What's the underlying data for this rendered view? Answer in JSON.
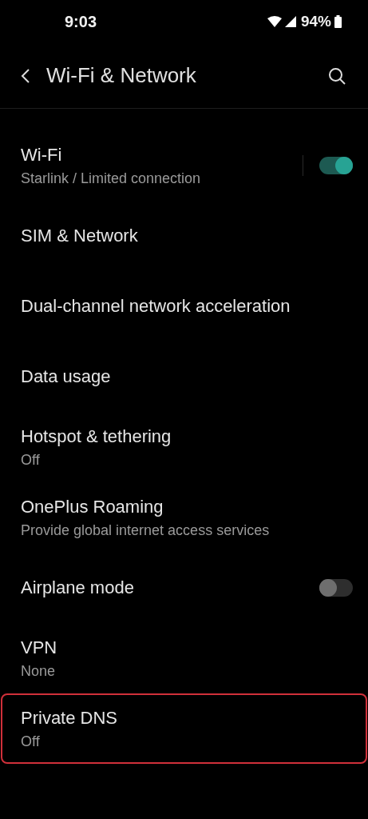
{
  "status_bar": {
    "time": "9:03",
    "battery": "94%"
  },
  "header": {
    "title": "Wi-Fi & Network"
  },
  "items": [
    {
      "kind": "toggle",
      "title": "Wi-Fi",
      "subtitle": "Starlink / Limited connection",
      "on": true,
      "highlighted": false
    },
    {
      "kind": "link",
      "title": "SIM & Network",
      "highlighted": false
    },
    {
      "kind": "link",
      "title": "Dual-channel network acceleration",
      "highlighted": false
    },
    {
      "kind": "link",
      "title": "Data usage",
      "highlighted": false
    },
    {
      "kind": "link",
      "title": "Hotspot & tethering",
      "subtitle": "Off",
      "highlighted": false
    },
    {
      "kind": "link",
      "title": "OnePlus Roaming",
      "subtitle": "Provide global internet access services",
      "highlighted": false
    },
    {
      "kind": "toggle",
      "title": "Airplane mode",
      "on": false,
      "highlighted": false
    },
    {
      "kind": "link",
      "title": "VPN",
      "subtitle": "None",
      "highlighted": false
    },
    {
      "kind": "link",
      "title": "Private DNS",
      "subtitle": "Off",
      "highlighted": true
    }
  ]
}
